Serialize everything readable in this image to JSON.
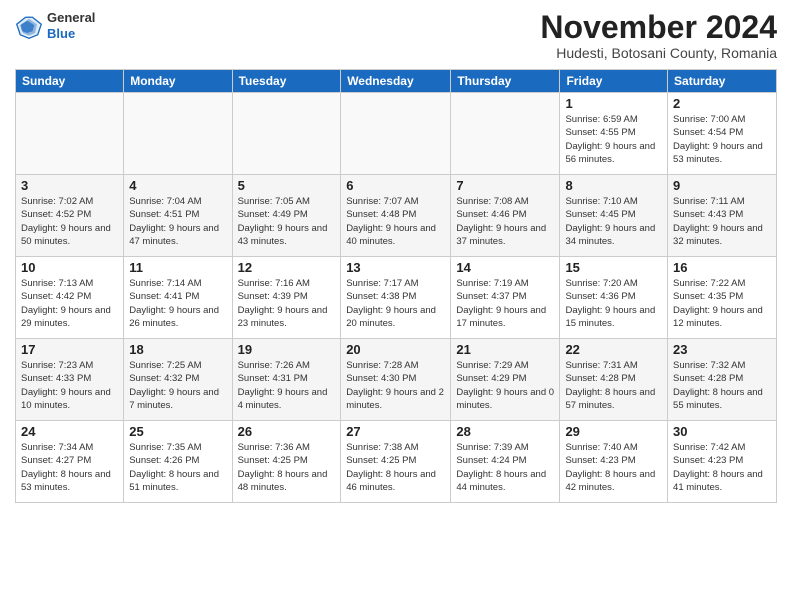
{
  "logo": {
    "general": "General",
    "blue": "Blue"
  },
  "title": "November 2024",
  "location": "Hudesti, Botosani County, Romania",
  "days_of_week": [
    "Sunday",
    "Monday",
    "Tuesday",
    "Wednesday",
    "Thursday",
    "Friday",
    "Saturday"
  ],
  "weeks": [
    [
      {
        "day": "",
        "info": ""
      },
      {
        "day": "",
        "info": ""
      },
      {
        "day": "",
        "info": ""
      },
      {
        "day": "",
        "info": ""
      },
      {
        "day": "",
        "info": ""
      },
      {
        "day": "1",
        "info": "Sunrise: 6:59 AM\nSunset: 4:55 PM\nDaylight: 9 hours and 56 minutes."
      },
      {
        "day": "2",
        "info": "Sunrise: 7:00 AM\nSunset: 4:54 PM\nDaylight: 9 hours and 53 minutes."
      }
    ],
    [
      {
        "day": "3",
        "info": "Sunrise: 7:02 AM\nSunset: 4:52 PM\nDaylight: 9 hours and 50 minutes."
      },
      {
        "day": "4",
        "info": "Sunrise: 7:04 AM\nSunset: 4:51 PM\nDaylight: 9 hours and 47 minutes."
      },
      {
        "day": "5",
        "info": "Sunrise: 7:05 AM\nSunset: 4:49 PM\nDaylight: 9 hours and 43 minutes."
      },
      {
        "day": "6",
        "info": "Sunrise: 7:07 AM\nSunset: 4:48 PM\nDaylight: 9 hours and 40 minutes."
      },
      {
        "day": "7",
        "info": "Sunrise: 7:08 AM\nSunset: 4:46 PM\nDaylight: 9 hours and 37 minutes."
      },
      {
        "day": "8",
        "info": "Sunrise: 7:10 AM\nSunset: 4:45 PM\nDaylight: 9 hours and 34 minutes."
      },
      {
        "day": "9",
        "info": "Sunrise: 7:11 AM\nSunset: 4:43 PM\nDaylight: 9 hours and 32 minutes."
      }
    ],
    [
      {
        "day": "10",
        "info": "Sunrise: 7:13 AM\nSunset: 4:42 PM\nDaylight: 9 hours and 29 minutes."
      },
      {
        "day": "11",
        "info": "Sunrise: 7:14 AM\nSunset: 4:41 PM\nDaylight: 9 hours and 26 minutes."
      },
      {
        "day": "12",
        "info": "Sunrise: 7:16 AM\nSunset: 4:39 PM\nDaylight: 9 hours and 23 minutes."
      },
      {
        "day": "13",
        "info": "Sunrise: 7:17 AM\nSunset: 4:38 PM\nDaylight: 9 hours and 20 minutes."
      },
      {
        "day": "14",
        "info": "Sunrise: 7:19 AM\nSunset: 4:37 PM\nDaylight: 9 hours and 17 minutes."
      },
      {
        "day": "15",
        "info": "Sunrise: 7:20 AM\nSunset: 4:36 PM\nDaylight: 9 hours and 15 minutes."
      },
      {
        "day": "16",
        "info": "Sunrise: 7:22 AM\nSunset: 4:35 PM\nDaylight: 9 hours and 12 minutes."
      }
    ],
    [
      {
        "day": "17",
        "info": "Sunrise: 7:23 AM\nSunset: 4:33 PM\nDaylight: 9 hours and 10 minutes."
      },
      {
        "day": "18",
        "info": "Sunrise: 7:25 AM\nSunset: 4:32 PM\nDaylight: 9 hours and 7 minutes."
      },
      {
        "day": "19",
        "info": "Sunrise: 7:26 AM\nSunset: 4:31 PM\nDaylight: 9 hours and 4 minutes."
      },
      {
        "day": "20",
        "info": "Sunrise: 7:28 AM\nSunset: 4:30 PM\nDaylight: 9 hours and 2 minutes."
      },
      {
        "day": "21",
        "info": "Sunrise: 7:29 AM\nSunset: 4:29 PM\nDaylight: 9 hours and 0 minutes."
      },
      {
        "day": "22",
        "info": "Sunrise: 7:31 AM\nSunset: 4:28 PM\nDaylight: 8 hours and 57 minutes."
      },
      {
        "day": "23",
        "info": "Sunrise: 7:32 AM\nSunset: 4:28 PM\nDaylight: 8 hours and 55 minutes."
      }
    ],
    [
      {
        "day": "24",
        "info": "Sunrise: 7:34 AM\nSunset: 4:27 PM\nDaylight: 8 hours and 53 minutes."
      },
      {
        "day": "25",
        "info": "Sunrise: 7:35 AM\nSunset: 4:26 PM\nDaylight: 8 hours and 51 minutes."
      },
      {
        "day": "26",
        "info": "Sunrise: 7:36 AM\nSunset: 4:25 PM\nDaylight: 8 hours and 48 minutes."
      },
      {
        "day": "27",
        "info": "Sunrise: 7:38 AM\nSunset: 4:25 PM\nDaylight: 8 hours and 46 minutes."
      },
      {
        "day": "28",
        "info": "Sunrise: 7:39 AM\nSunset: 4:24 PM\nDaylight: 8 hours and 44 minutes."
      },
      {
        "day": "29",
        "info": "Sunrise: 7:40 AM\nSunset: 4:23 PM\nDaylight: 8 hours and 42 minutes."
      },
      {
        "day": "30",
        "info": "Sunrise: 7:42 AM\nSunset: 4:23 PM\nDaylight: 8 hours and 41 minutes."
      }
    ]
  ]
}
